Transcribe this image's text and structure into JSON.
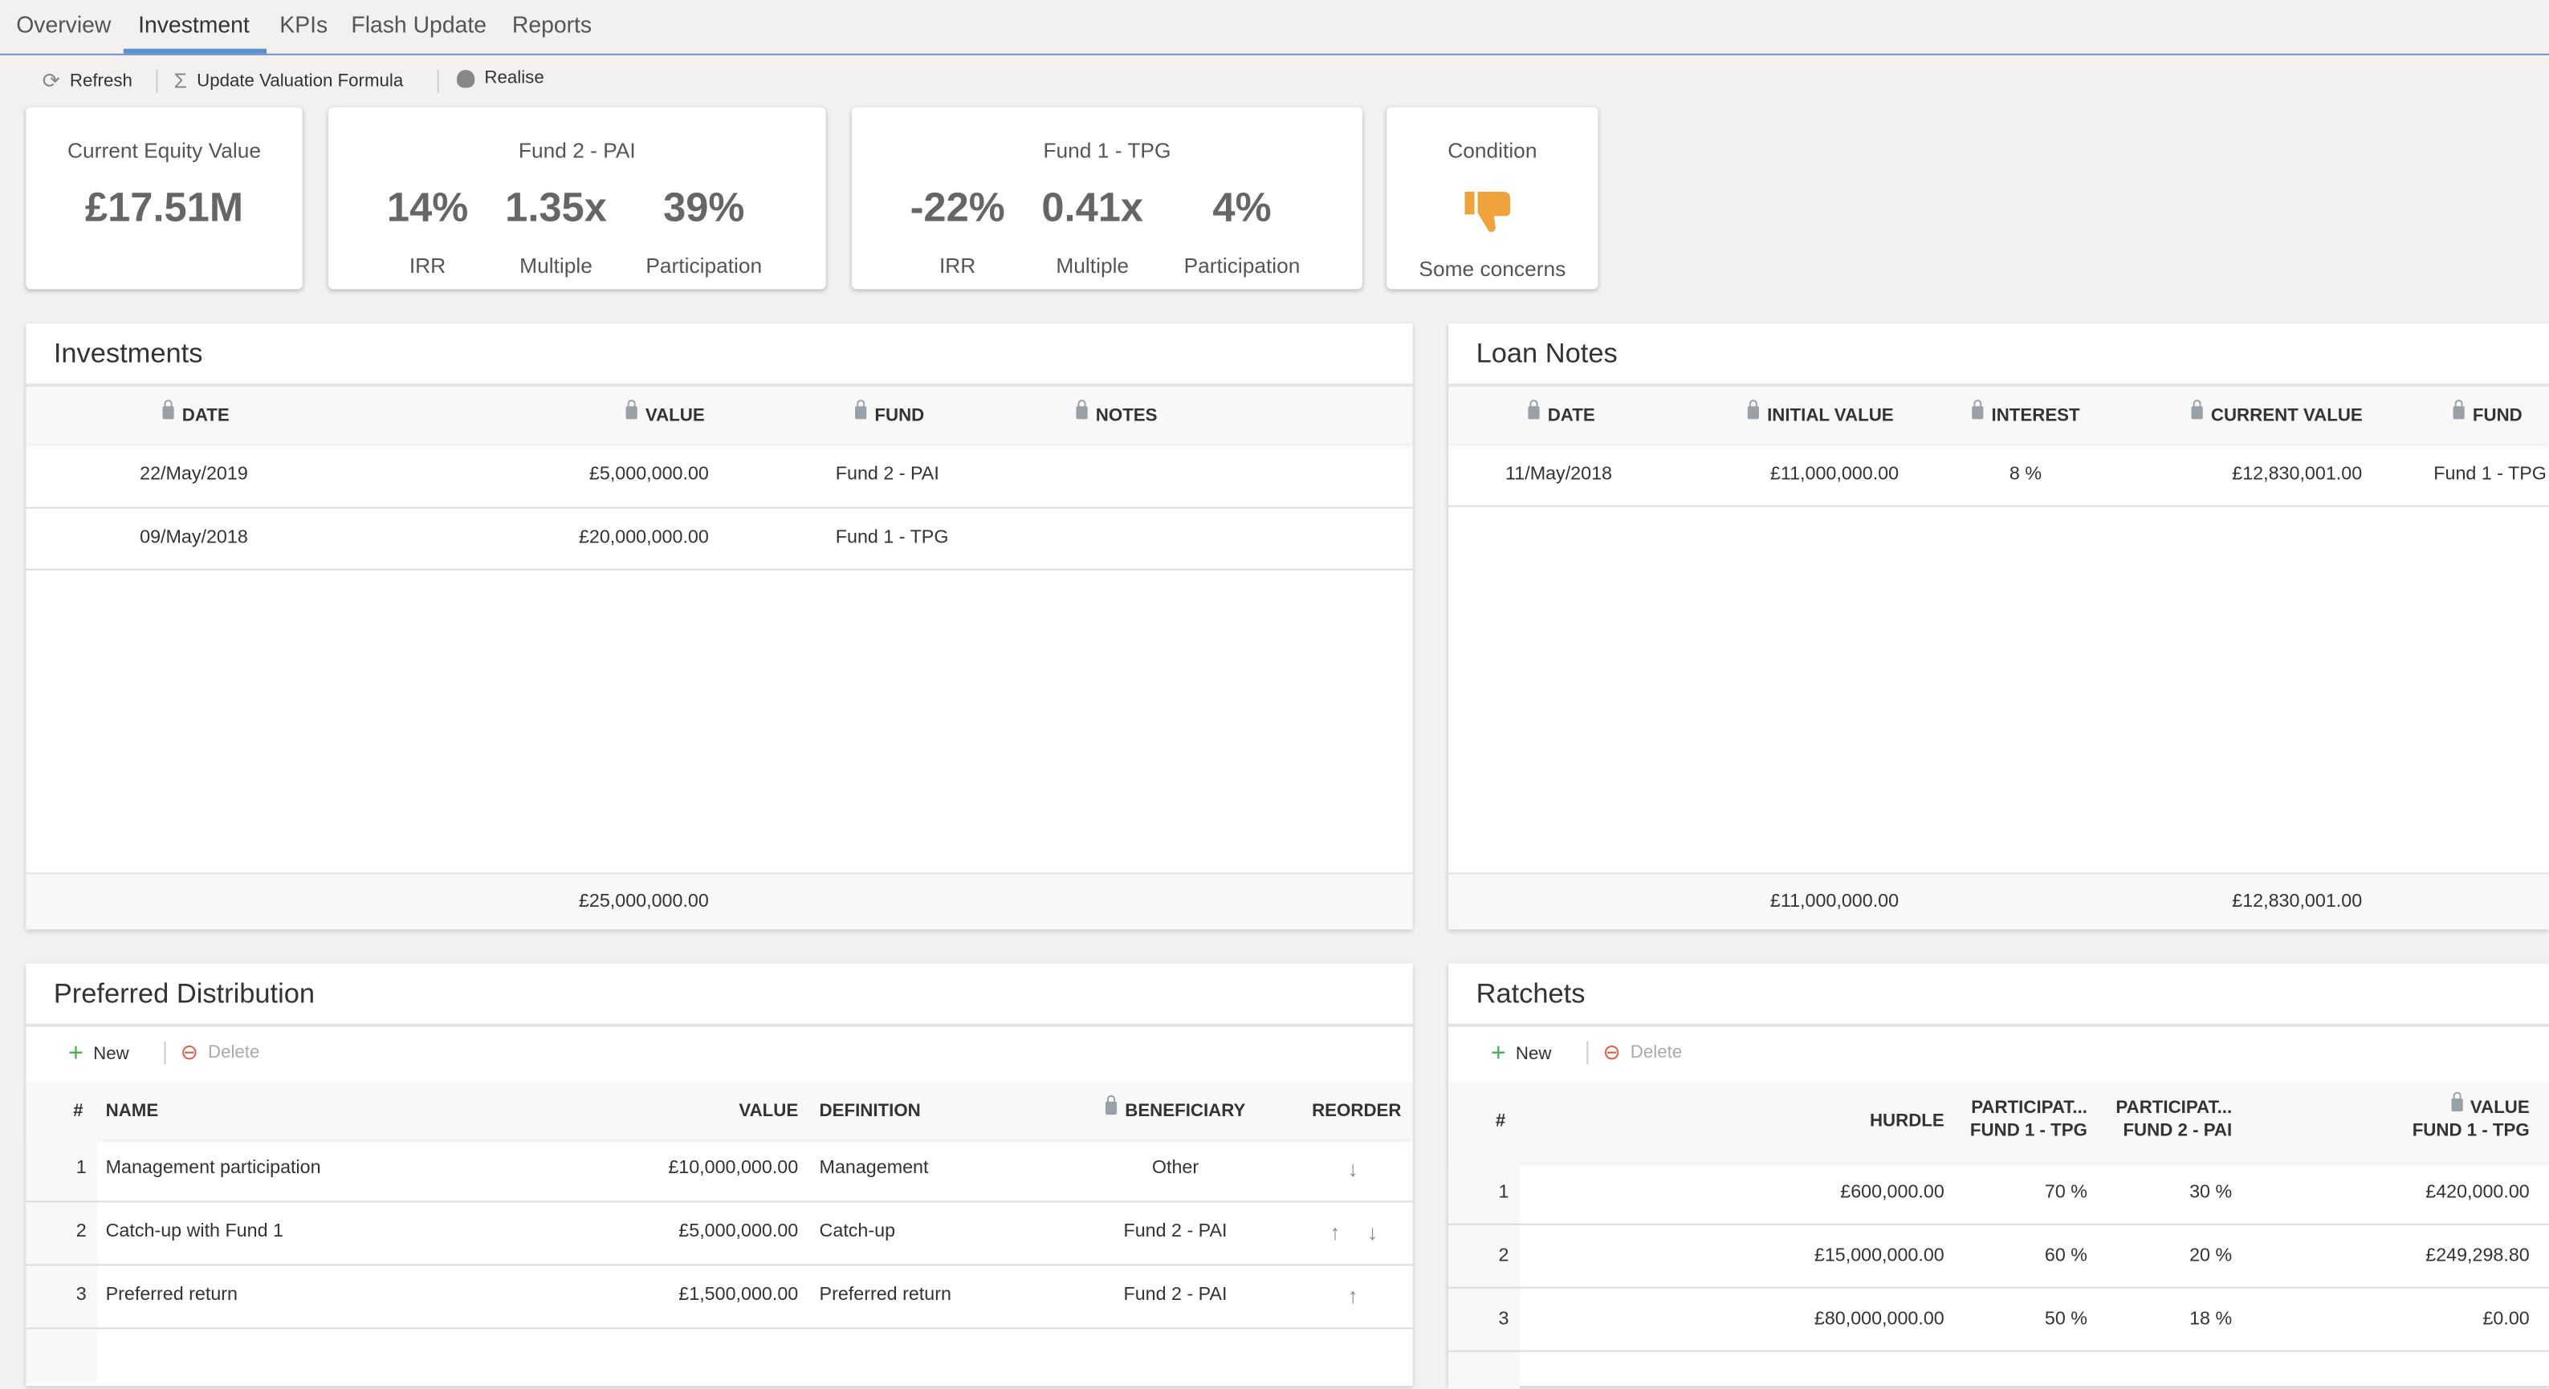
{
  "tabs": [
    {
      "label": "Overview"
    },
    {
      "label": "Investment",
      "active": true
    },
    {
      "label": "KPIs"
    },
    {
      "label": "Flash Update"
    },
    {
      "label": "Reports"
    }
  ],
  "toolbar": {
    "refresh": "Refresh",
    "update_formula": "Update Valuation Formula",
    "realise": "Realise"
  },
  "cards": {
    "equity": {
      "title": "Current Equity Value",
      "value": "£17.51M"
    },
    "fund2": {
      "title": "Fund 2 - PAI",
      "irr": "14%",
      "multiple": "1.35x",
      "participation": "39%",
      "irr_label": "IRR",
      "multiple_label": "Multiple",
      "participation_label": "Participation"
    },
    "fund1": {
      "title": "Fund 1 - TPG",
      "irr": "-22%",
      "multiple": "0.41x",
      "participation": "4%",
      "irr_label": "IRR",
      "multiple_label": "Multiple",
      "participation_label": "Participation"
    },
    "condition": {
      "title": "Condition",
      "status": "Some concerns",
      "icon": "thumbs-down-icon",
      "color": "#f0a33a"
    }
  },
  "investments": {
    "title": "Investments",
    "headers": [
      "DATE",
      "VALUE",
      "FUND",
      "NOTES"
    ],
    "rows": [
      {
        "date": "22/May/2019",
        "value": "£5,000,000.00",
        "fund": "Fund 2 - PAI",
        "notes": ""
      },
      {
        "date": "09/May/2018",
        "value": "£20,000,000.00",
        "fund": "Fund 1 - TPG",
        "notes": ""
      }
    ],
    "total": "£25,000,000.00"
  },
  "loan_notes": {
    "title": "Loan Notes",
    "headers": [
      "DATE",
      "INITIAL VALUE",
      "INTEREST",
      "CURRENT VALUE",
      "FUND"
    ],
    "rows": [
      {
        "date": "11/May/2018",
        "initial": "£11,000,000.00",
        "interest": "8 %",
        "current": "£12,830,001.00",
        "fund": "Fund 1 - TPG"
      }
    ],
    "total_initial": "£11,000,000.00",
    "total_current": "£12,830,001.00"
  },
  "preferred": {
    "title": "Preferred Distribution",
    "new": "New",
    "delete": "Delete",
    "headers": [
      "#",
      "NAME",
      "VALUE",
      "DEFINITION",
      "BENEFICIARY",
      "REORDER"
    ],
    "rows": [
      {
        "n": "1",
        "name": "Management participation",
        "value": "£10,000,000.00",
        "definition": "Management",
        "beneficiary": "Other",
        "up": false,
        "down": true
      },
      {
        "n": "2",
        "name": "Catch-up with Fund 1",
        "value": "£5,000,000.00",
        "definition": "Catch-up",
        "beneficiary": "Fund 2 - PAI",
        "up": true,
        "down": true
      },
      {
        "n": "3",
        "name": "Preferred return",
        "value": "£1,500,000.00",
        "definition": "Preferred return",
        "beneficiary": "Fund 2 - PAI",
        "up": true,
        "down": false
      }
    ]
  },
  "ratchets": {
    "title": "Ratchets",
    "new": "New",
    "delete": "Delete",
    "headers": {
      "n": "#",
      "hurdle": "HURDLE",
      "p1a": "PARTICIPAT...",
      "p1b": "FUND 1 - TPG",
      "p2a": "PARTICIPAT...",
      "p2b": "FUND 2 - PAI",
      "va": "VALUE",
      "vb": "FUND 1 - TPG"
    },
    "rows": [
      {
        "n": "1",
        "hurdle": "£600,000.00",
        "p1": "70 %",
        "p2": "30 %",
        "value": "£420,000.00"
      },
      {
        "n": "2",
        "hurdle": "£15,000,000.00",
        "p1": "60 %",
        "p2": "20 %",
        "value": "£249,298.80"
      },
      {
        "n": "3",
        "hurdle": "£80,000,000.00",
        "p1": "50 %",
        "p2": "18 %",
        "value": "£0.00"
      }
    ]
  }
}
